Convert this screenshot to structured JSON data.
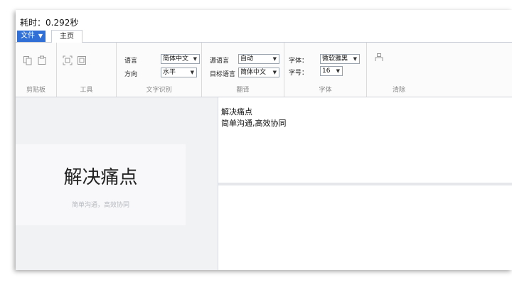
{
  "title": "耗时：0.292秒",
  "tabs": {
    "file": "文件",
    "home": "主页"
  },
  "ribbon": {
    "clipboard": {
      "label": "剪贴板"
    },
    "tools": {
      "label": "工具"
    },
    "ocr": {
      "label": "文字识别",
      "language_label": "语言",
      "language_value": "简体中文",
      "direction_label": "方向",
      "direction_value": "水平"
    },
    "translate": {
      "label": "翻译",
      "source_label": "源语言",
      "source_value": "自动",
      "target_label": "目标语言",
      "target_value": "简体中文"
    },
    "font": {
      "label": "字体",
      "font_label": "字体：",
      "font_value": "微软雅黑",
      "size_label": "字号：",
      "size_value": "16"
    },
    "clear": {
      "label": "清除"
    }
  },
  "image": {
    "title": "解决痛点",
    "subtitle": "简单沟通，高效协同"
  },
  "result": {
    "lines": [
      "解决痛点",
      "简单沟通,高效协同"
    ]
  }
}
